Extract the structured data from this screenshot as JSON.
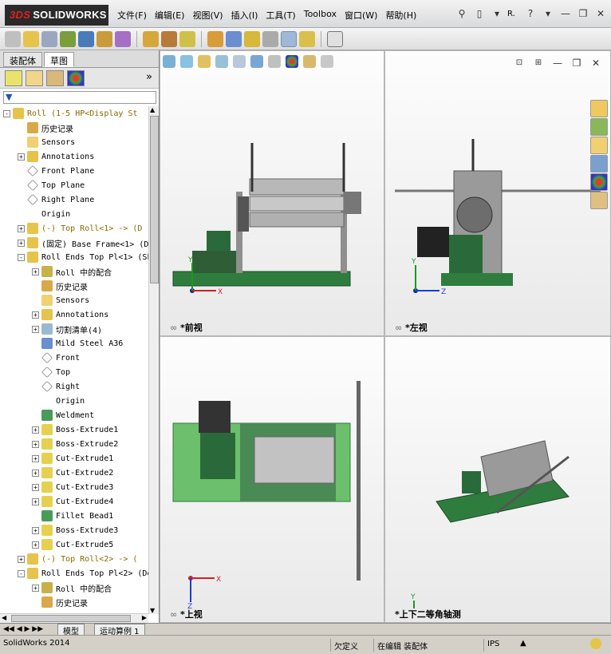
{
  "app": {
    "logo_prefix": "3DS",
    "logo_text": "SOLIDWORKS",
    "title_short": "R."
  },
  "menu": [
    "文件(F)",
    "编辑(E)",
    "视图(V)",
    "插入(I)",
    "工具(T)",
    "Toolbox",
    "窗口(W)",
    "帮助(H)"
  ],
  "left_panel": {
    "tabs": [
      "装配体",
      "草图"
    ],
    "more": "»"
  },
  "tree": [
    {
      "indent": 0,
      "expander": "-",
      "icon": "assembly-warning",
      "label": "Roll  (1-5 HP<Display St",
      "warn": true
    },
    {
      "indent": 1,
      "expander": "",
      "icon": "history",
      "label": "历史记录"
    },
    {
      "indent": 1,
      "expander": "",
      "icon": "sensors",
      "label": "Sensors"
    },
    {
      "indent": 1,
      "expander": "+",
      "icon": "annotations",
      "label": "Annotations"
    },
    {
      "indent": 1,
      "expander": "",
      "icon": "plane",
      "label": "Front Plane"
    },
    {
      "indent": 1,
      "expander": "",
      "icon": "plane",
      "label": "Top Plane"
    },
    {
      "indent": 1,
      "expander": "",
      "icon": "plane",
      "label": "Right Plane"
    },
    {
      "indent": 1,
      "expander": "",
      "icon": "origin",
      "label": "Origin"
    },
    {
      "indent": 1,
      "expander": "+",
      "icon": "part-warning",
      "label": "(-) Top Roll<1> -> (D",
      "warn": true
    },
    {
      "indent": 1,
      "expander": "+",
      "icon": "part",
      "label": "(固定) Base Frame<1> (De"
    },
    {
      "indent": 1,
      "expander": "-",
      "icon": "part",
      "label": "Roll Ends Top Pl<1> (Sh"
    },
    {
      "indent": 2,
      "expander": "+",
      "icon": "mates",
      "label": "Roll 中的配合"
    },
    {
      "indent": 2,
      "expander": "",
      "icon": "history",
      "label": "历史记录"
    },
    {
      "indent": 2,
      "expander": "",
      "icon": "sensors",
      "label": "Sensors"
    },
    {
      "indent": 2,
      "expander": "+",
      "icon": "annotations",
      "label": "Annotations"
    },
    {
      "indent": 2,
      "expander": "+",
      "icon": "cutlist",
      "label": "切割清单(4)"
    },
    {
      "indent": 2,
      "expander": "",
      "icon": "material",
      "label": "Mild Steel A36"
    },
    {
      "indent": 2,
      "expander": "",
      "icon": "plane",
      "label": "Front"
    },
    {
      "indent": 2,
      "expander": "",
      "icon": "plane",
      "label": "Top"
    },
    {
      "indent": 2,
      "expander": "",
      "icon": "plane",
      "label": "Right"
    },
    {
      "indent": 2,
      "expander": "",
      "icon": "origin",
      "label": "Origin"
    },
    {
      "indent": 2,
      "expander": "",
      "icon": "weldment",
      "label": "Weldment"
    },
    {
      "indent": 2,
      "expander": "+",
      "icon": "feature",
      "label": "Boss-Extrude1"
    },
    {
      "indent": 2,
      "expander": "+",
      "icon": "feature",
      "label": "Boss-Extrude2"
    },
    {
      "indent": 2,
      "expander": "+",
      "icon": "feature",
      "label": "Cut-Extrude1"
    },
    {
      "indent": 2,
      "expander": "+",
      "icon": "feature",
      "label": "Cut-Extrude2"
    },
    {
      "indent": 2,
      "expander": "+",
      "icon": "feature",
      "label": "Cut-Extrude3"
    },
    {
      "indent": 2,
      "expander": "+",
      "icon": "feature",
      "label": "Cut-Extrude4"
    },
    {
      "indent": 2,
      "expander": "",
      "icon": "weldment",
      "label": "Fillet Bead1"
    },
    {
      "indent": 2,
      "expander": "+",
      "icon": "feature",
      "label": "Boss-Extrude3"
    },
    {
      "indent": 2,
      "expander": "+",
      "icon": "feature",
      "label": "Cut-Extrude5"
    },
    {
      "indent": 1,
      "expander": "+",
      "icon": "part-warning",
      "label": "(-) Top Roll<2> -> (",
      "warn": true
    },
    {
      "indent": 1,
      "expander": "-",
      "icon": "part",
      "label": "Roll Ends Top Pl<2> (De"
    },
    {
      "indent": 2,
      "expander": "+",
      "icon": "mates",
      "label": "Roll 中的配合"
    },
    {
      "indent": 2,
      "expander": "",
      "icon": "history",
      "label": "历史记录"
    }
  ],
  "views": {
    "front": "*前视",
    "left": "*左视",
    "top": "*上视",
    "iso": "*上下二等角轴测"
  },
  "axis": {
    "x": "X",
    "y": "Y",
    "z": "Z"
  },
  "bottom_tabs": [
    "模型",
    "运动算例 1"
  ],
  "status": {
    "app": "SolidWorks 2014",
    "undefined": "欠定义",
    "mode": "在编辑 装配体",
    "units": "IPS"
  },
  "colors": {
    "frame_green": "#2e7d3e",
    "base_green": "#6cbf6c",
    "accent_red": "#d02020"
  }
}
